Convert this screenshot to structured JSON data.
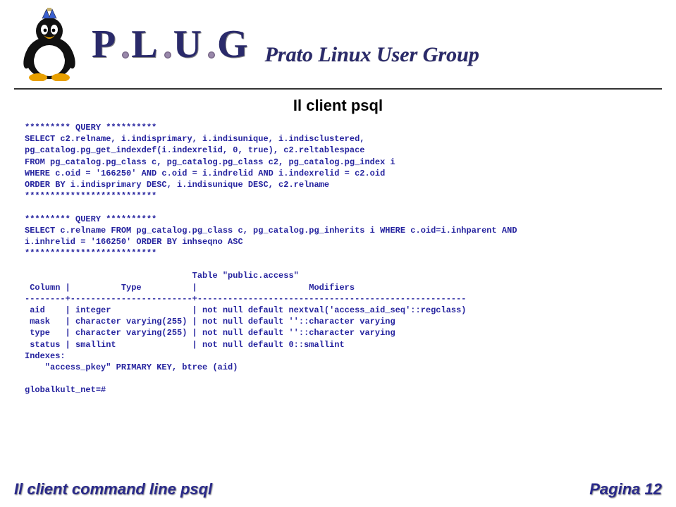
{
  "header": {
    "logo_text": "PLUG",
    "subtitle": "Prato Linux User Group"
  },
  "slide": {
    "title": "Il client psql"
  },
  "code": {
    "block": "********* QUERY **********\nSELECT c2.relname, i.indisprimary, i.indisunique, i.indisclustered,\npg_catalog.pg_get_indexdef(i.indexrelid, 0, true), c2.reltablespace\nFROM pg_catalog.pg_class c, pg_catalog.pg_class c2, pg_catalog.pg_index i\nWHERE c.oid = '166250' AND c.oid = i.indrelid AND i.indexrelid = c2.oid\nORDER BY i.indisprimary DESC, i.indisunique DESC, c2.relname\n**************************\n\n********* QUERY **********\nSELECT c.relname FROM pg_catalog.pg_class c, pg_catalog.pg_inherits i WHERE c.oid=i.inhparent AND\ni.inhrelid = '166250' ORDER BY inhseqno ASC\n**************************\n\n                                 Table \"public.access\"\n Column |          Type          |                      Modifiers\n--------+------------------------+-----------------------------------------------------\n aid    | integer                | not null default nextval('access_aid_seq'::regclass)\n mask   | character varying(255) | not null default ''::character varying\n type   | character varying(255) | not null default ''::character varying\n status | smallint               | not null default 0::smallint\nIndexes:\n    \"access_pkey\" PRIMARY KEY, btree (aid)\n\nglobalkult_net=#"
  },
  "footer": {
    "left": "Il client command line psql",
    "right_label": "Pagina",
    "page": "12"
  }
}
